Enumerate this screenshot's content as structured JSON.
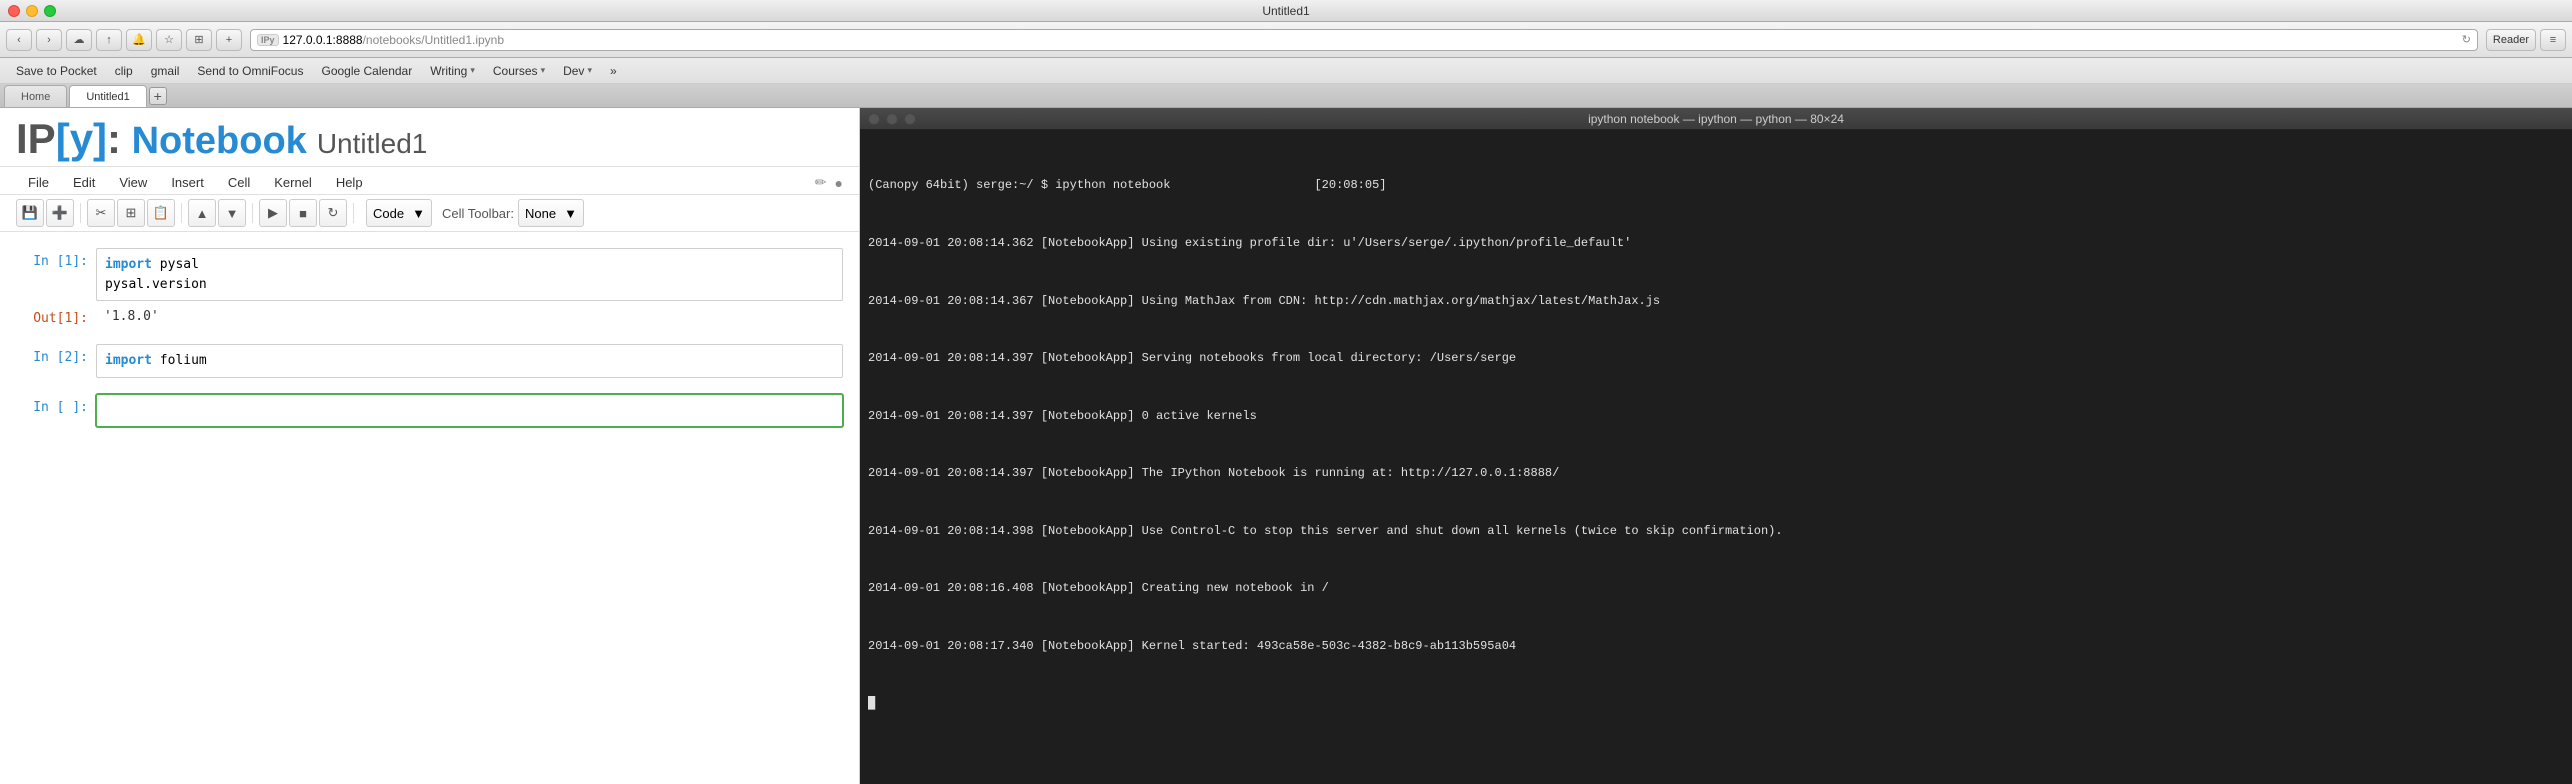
{
  "browser": {
    "title": "Untitled1",
    "traffic_lights": [
      "red",
      "yellow",
      "green"
    ],
    "nav_back": "‹",
    "nav_fwd": "›",
    "address_prefix": "IPy",
    "address_url": "127.0.0.1:8888",
    "address_path": "/notebooks/Untitled1.ipynb",
    "reader_btn": "Reader",
    "bookmarks": [
      {
        "label": "Save to Pocket"
      },
      {
        "label": "clip"
      },
      {
        "label": "gmail"
      },
      {
        "label": "Send to OmniFocus"
      },
      {
        "label": "Google Calendar"
      },
      {
        "label": "Writing",
        "dropdown": true
      },
      {
        "label": "Courses",
        "dropdown": true
      },
      {
        "label": "Dev",
        "dropdown": true
      },
      {
        "label": "»"
      }
    ]
  },
  "tabs": [
    {
      "label": "Home",
      "active": false
    },
    {
      "label": "Untitled1",
      "active": true
    }
  ],
  "notebook": {
    "logo_ip": "IP",
    "logo_bracket_open": "[",
    "logo_y": "y",
    "logo_bracket_close": "]",
    "logo_colon": ":",
    "logo_nb": " Notebook",
    "title": "Untitled1",
    "menu": [
      "File",
      "Edit",
      "View",
      "Insert",
      "Cell",
      "Kernel",
      "Help"
    ],
    "toolbar_buttons": [
      "💾",
      "➕",
      "✂",
      "⧉",
      "📋",
      "▲",
      "▼",
      "▶",
      "■",
      "↻"
    ],
    "cell_type": "Code",
    "cell_toolbar_label": "Cell Toolbar:",
    "cell_toolbar_value": "None",
    "cells": [
      {
        "prompt": "In [1]:",
        "type": "in",
        "code": "import pysal\npysal.version",
        "active": false
      },
      {
        "prompt": "Out[1]:",
        "type": "out",
        "output": "'1.8.0'",
        "active": false
      },
      {
        "prompt": "In [2]:",
        "type": "in",
        "code": "import folium",
        "active": false
      },
      {
        "prompt": "In [ ]:",
        "type": "in",
        "code": "",
        "active": true
      }
    ]
  },
  "terminal": {
    "window_title": "ipython notebook — ipython — python — 80×24",
    "lines": [
      "(Canopy 64bit) serge:~/ $ ipython notebook                    [20:08:05]",
      "2014-09-01 20:08:14.362 [NotebookApp] Using existing profile dir: u'/Users/serge/.ipython/profile_default'",
      "2014-09-01 20:08:14.367 [NotebookApp] Using MathJax from CDN: http://cdn.mathjax.org/mathjax/latest/MathJax.js",
      "2014-09-01 20:08:14.397 [NotebookApp] Serving notebooks from local directory: /Users/serge",
      "2014-09-01 20:08:14.397 [NotebookApp] 0 active kernels",
      "2014-09-01 20:08:14.397 [NotebookApp] The IPython Notebook is running at: http://127.0.0.1:8888/",
      "2014-09-01 20:08:14.398 [NotebookApp] Use Control-C to stop this server and shut down all kernels (twice to skip confirmation).",
      "2014-09-01 20:08:16.408 [NotebookApp] Creating new notebook in /",
      "2014-09-01 20:08:17.340 [NotebookApp] Kernel started: 493ca58e-503c-4382-b8c9-ab113b595a04",
      "█"
    ]
  }
}
